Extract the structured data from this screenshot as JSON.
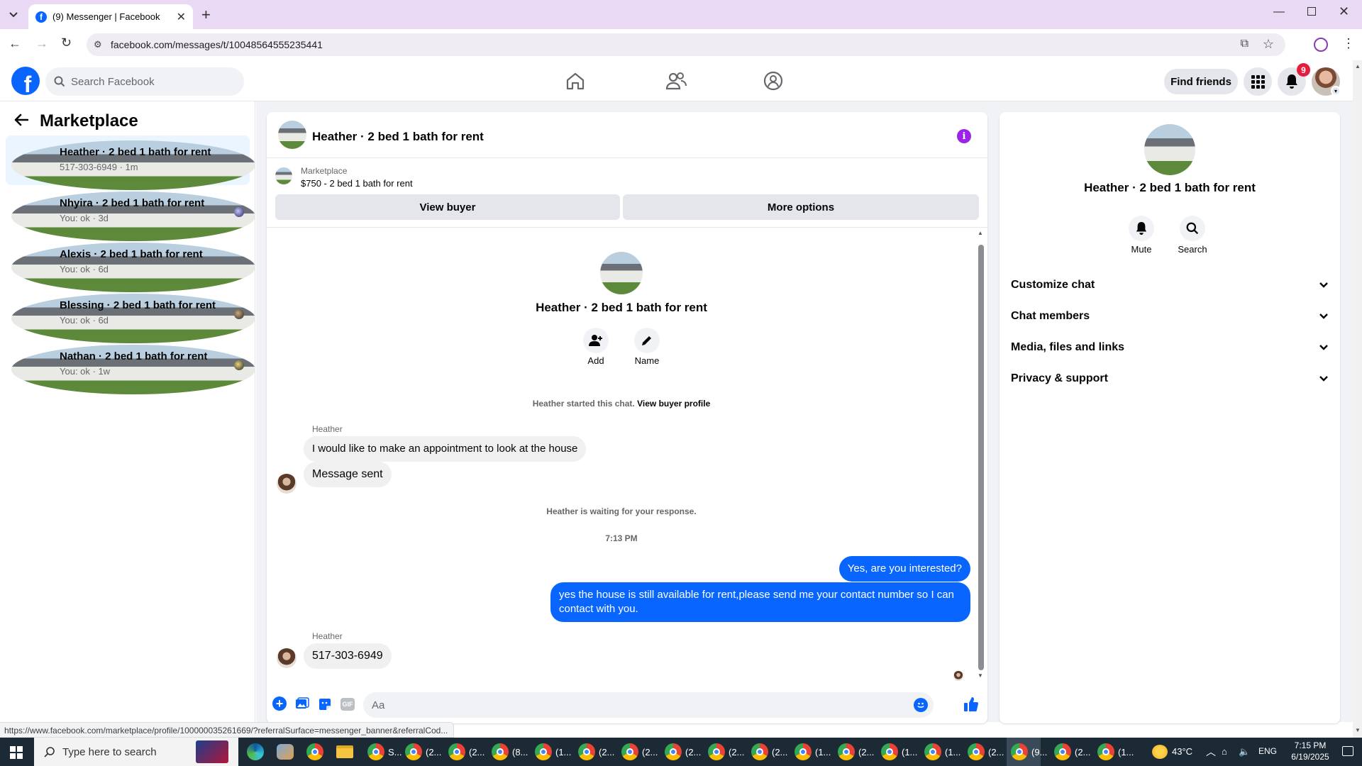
{
  "browser": {
    "tab_title": "(9) Messenger | Facebook",
    "url": "facebook.com/messages/t/10048564555235441",
    "status_url": "https://www.facebook.com/marketplace/profile/100000035261669/?referralSurface=messenger_banner&referralCod..."
  },
  "header": {
    "search_placeholder": "Search Facebook",
    "find_friends": "Find friends",
    "notifications_count": "9"
  },
  "sidebar": {
    "title": "Marketplace",
    "conversations": [
      {
        "name": "Heather · 2 bed 1 bath for rent",
        "sub": "517-303-6949 · 1m"
      },
      {
        "name": "Nhyira · 2 bed 1 bath for rent",
        "sub": "You: ok · 3d"
      },
      {
        "name": "Alexis · 2 bed 1 bath for rent",
        "sub": "You: ok · 6d"
      },
      {
        "name": "Blessing · 2 bed 1 bath for rent",
        "sub": "You: ok · 6d"
      },
      {
        "name": "Nathan · 2 bed 1 bath for rent",
        "sub": "You: ok · 1w"
      }
    ]
  },
  "chat": {
    "title": "Heather · 2 bed 1 bath for rent",
    "listing_label": "Marketplace",
    "listing_text": "$750 - 2 bed 1 bath for rent",
    "view_buyer": "View buyer",
    "more_options": "More options",
    "profile_name": "Heather · 2 bed 1 bath for rent",
    "add_label": "Add",
    "name_label": "Name",
    "started_text": "Heather started this chat.",
    "view_buyer_profile": "View buyer profile",
    "sender1": "Heather",
    "msg1": "I would like to make an appointment to look at the house",
    "msg2": "Message sent",
    "waiting": "Heather is waiting for your response.",
    "time": "7:13 PM",
    "out1": "Yes, are you interested?",
    "out2": "yes the house is still available for rent,please send me your contact number so I can contact with you.",
    "sender2": "Heather",
    "msg3": "517-303-6949",
    "composer_placeholder": "Aa"
  },
  "info": {
    "name": "Heather · 2 bed 1 bath for rent",
    "mute": "Mute",
    "search": "Search",
    "sections": [
      "Customize chat",
      "Chat members",
      "Media, files and links",
      "Privacy & support"
    ]
  },
  "taskbar": {
    "search_placeholder": "Type here to search",
    "apps": [
      "S...",
      "(2...",
      "(2...",
      "(8...",
      "(1...",
      "(2...",
      "(2...",
      "(2...",
      "(2...",
      "(2...",
      "(1...",
      "(2...",
      "(1...",
      "(1...",
      "(2...",
      "(9...",
      "(2...",
      "(1..."
    ],
    "weather": "43°C",
    "lang": "ENG",
    "clock_time": "7:15 PM",
    "clock_date": "6/19/2025"
  }
}
